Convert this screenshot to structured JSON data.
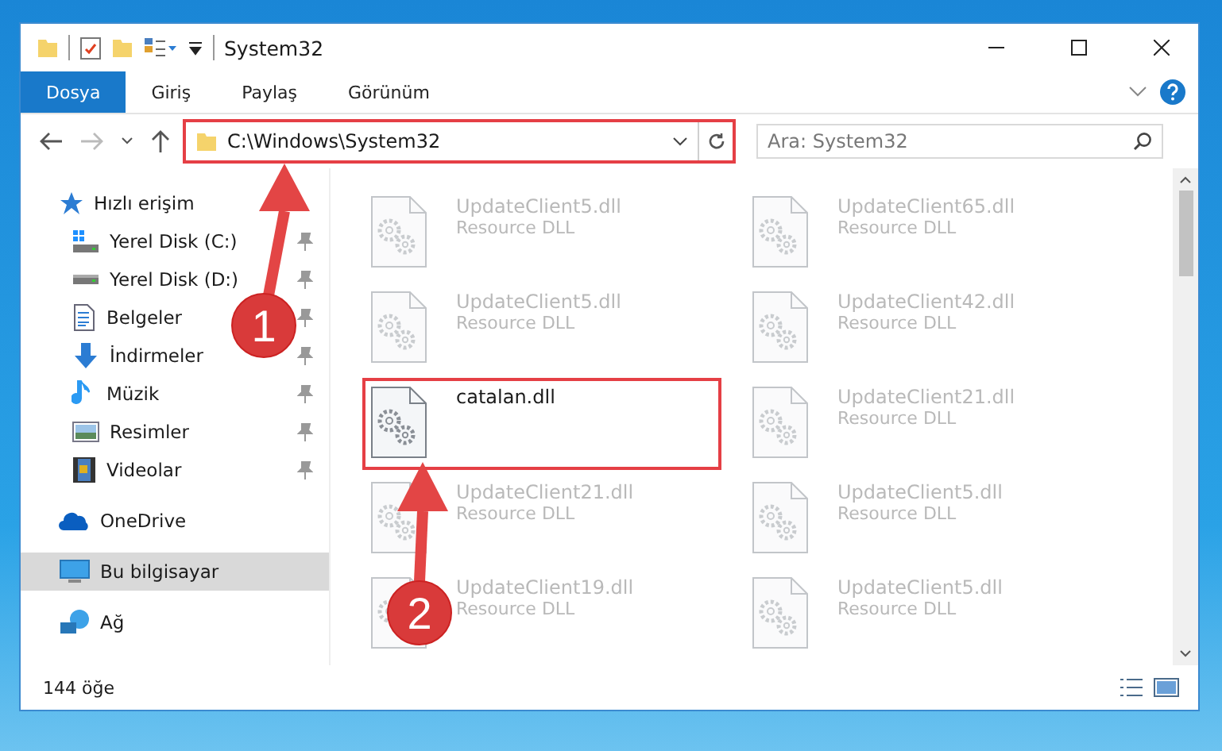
{
  "window": {
    "title": "System32"
  },
  "ribbon_tabs": [
    {
      "label": "Dosya",
      "selected": true
    },
    {
      "label": "Giriş",
      "selected": false
    },
    {
      "label": "Paylaş",
      "selected": false
    },
    {
      "label": "Görünüm",
      "selected": false
    }
  ],
  "address": {
    "path": "C:\\Windows\\System32",
    "highlighted": true
  },
  "search": {
    "placeholder": "Ara: System32"
  },
  "sidebar": {
    "items": [
      {
        "label": "Hızlı erişim",
        "kind": "star",
        "selected": false,
        "children": [
          {
            "label": "Yerel Disk (C:)",
            "kind": "drive-windows",
            "pinned": true,
            "selected": false
          },
          {
            "label": "Yerel Disk (D:)",
            "kind": "drive",
            "pinned": true,
            "selected": false
          },
          {
            "label": "Belgeler",
            "kind": "documents",
            "pinned": true,
            "selected": false
          },
          {
            "label": "İndirmeler",
            "kind": "download",
            "pinned": true,
            "selected": false
          },
          {
            "label": "Müzik",
            "kind": "music",
            "pinned": true,
            "selected": false
          },
          {
            "label": "Resimler",
            "kind": "pictures",
            "pinned": true,
            "selected": false
          },
          {
            "label": "Videolar",
            "kind": "videos",
            "pinned": true,
            "selected": false
          }
        ]
      },
      {
        "label": "OneDrive",
        "kind": "cloud",
        "selected": false
      },
      {
        "label": "Bu bilgisayar",
        "kind": "computer",
        "selected": true
      },
      {
        "label": "Ağ",
        "kind": "network",
        "selected": false
      }
    ]
  },
  "files": [
    {
      "name": "UpdateClient5.dll",
      "type": "Resource DLL",
      "faded": true,
      "highlighted": false
    },
    {
      "name": "UpdateClient65.dll",
      "type": "Resource DLL",
      "faded": true,
      "highlighted": false
    },
    {
      "name": "UpdateClient5.dll",
      "type": "Resource DLL",
      "faded": true,
      "highlighted": false
    },
    {
      "name": "UpdateClient42.dll",
      "type": "Resource DLL",
      "faded": true,
      "highlighted": false
    },
    {
      "name": "catalan.dll",
      "faded": false,
      "highlighted": true
    },
    {
      "name": "UpdateClient21.dll",
      "type": "Resource DLL",
      "faded": true,
      "highlighted": false
    },
    {
      "name": "UpdateClient21.dll",
      "type": "Resource DLL",
      "faded": true,
      "highlighted": false
    },
    {
      "name": "UpdateClient5.dll",
      "type": "Resource DLL",
      "faded": true,
      "highlighted": false
    },
    {
      "name": "UpdateClient19.dll",
      "type": "Resource DLL",
      "faded": true,
      "highlighted": false
    },
    {
      "name": "UpdateClient5.dll",
      "type": "Resource DLL",
      "faded": true,
      "highlighted": false
    }
  ],
  "annotations": [
    {
      "number": "1"
    },
    {
      "number": "2"
    }
  ],
  "status_bar": {
    "count": "144 öğe"
  }
}
